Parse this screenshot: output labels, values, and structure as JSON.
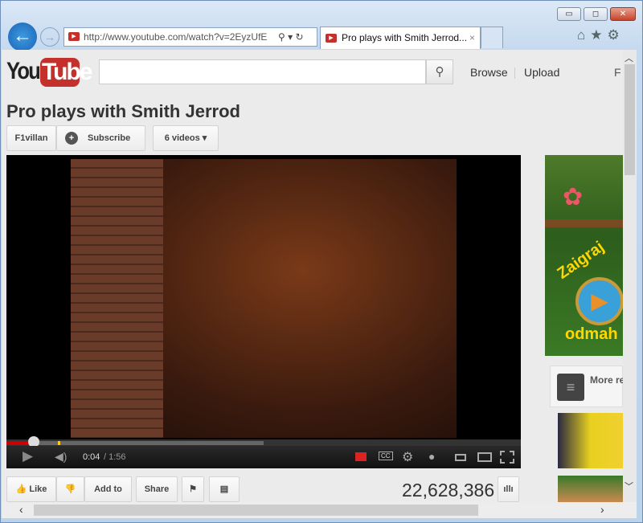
{
  "browser": {
    "url": "http://www.youtube.com/watch?v=2EyzUfE",
    "tab_title": "Pro plays with Smith Jerrod...",
    "min": "▭",
    "restore": "◻",
    "close": "✕"
  },
  "header": {
    "logo_you": "You",
    "logo_tube": "Tube",
    "search_placeholder": "",
    "browse": "Browse",
    "upload": "Upload",
    "cut_link": "F"
  },
  "video": {
    "title": "Pro plays with Smith Jerrod",
    "channel": "F1villan",
    "subscribe": "Subscribe",
    "videos": "6 videos",
    "current_time": "0:04",
    "duration": "/ 1:56",
    "played_fraction": 0.034,
    "buffered_fraction": 0.5
  },
  "actions": {
    "like": "Like",
    "add_to": "Add to",
    "share": "Share",
    "views": "22,628,386"
  },
  "sidebar": {
    "ad_text1": "Zaigraj",
    "ad_text2": "odmah",
    "more": "More re"
  }
}
